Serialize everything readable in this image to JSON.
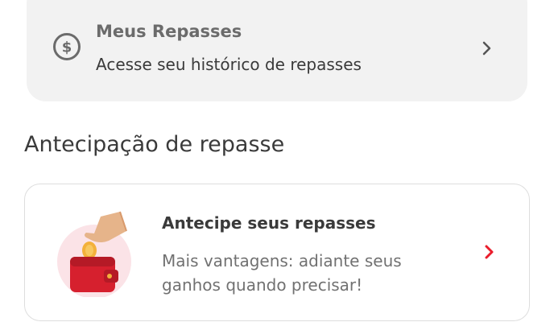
{
  "repasses_card": {
    "icon": "dollar-circle-icon",
    "title": "Meus Repasses",
    "subtitle": "Acesse seu histórico de repasses"
  },
  "section": {
    "title": "Antecipação de repasse"
  },
  "antecipe_card": {
    "illustration": "wallet-with-coin-illustration",
    "title": "Antecipe seus repasses",
    "description": "Mais vantagens: adiante seus ganhos quando precisar!",
    "chevron_color": "#ea1d2c"
  },
  "colors": {
    "card_bg": "#f2f2f2",
    "accent": "#ea1d2c",
    "text_primary": "#3a3a3a",
    "text_secondary": "#717171"
  }
}
